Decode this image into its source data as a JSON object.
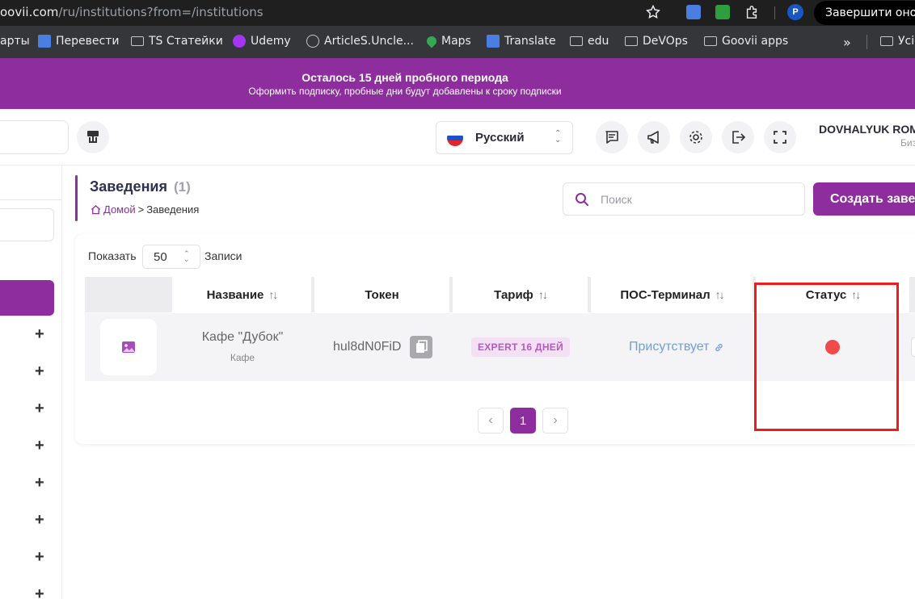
{
  "browser": {
    "url_host": "oovii.com",
    "url_path": "/ru/institutions?from=/institutions",
    "end_session_label": "Завершити оно",
    "profile_initial": "P",
    "bookmarks": [
      {
        "label": "арты",
        "icon": "folder-icon"
      },
      {
        "label": "Перевести",
        "icon": "google-translate-icon"
      },
      {
        "label": "TS Статейки",
        "icon": "folder-icon"
      },
      {
        "label": "Udemy",
        "icon": "udemy-icon"
      },
      {
        "label": "ArticleS.Uncle...",
        "icon": "globe-icon"
      },
      {
        "label": "Maps",
        "icon": "maps-icon"
      },
      {
        "label": "Translate",
        "icon": "google-translate-icon"
      },
      {
        "label": "edu",
        "icon": "folder-icon"
      },
      {
        "label": "DeVOps",
        "icon": "folder-icon"
      },
      {
        "label": "Goovii apps",
        "icon": "folder-icon"
      },
      {
        "label": "»",
        "icon": "overflow-icon"
      },
      {
        "label": "Усі",
        "icon": "folder-icon"
      }
    ]
  },
  "trial": {
    "title": "Осталось 15 дней пробного периода",
    "subtitle": "Оформить подписку, пробные дни будут добавлены к сроку подписки"
  },
  "header": {
    "language": "Русский",
    "user_name": "DOVHALYUK ROM",
    "user_role": "Биз"
  },
  "page": {
    "title": "Заведения",
    "count": "(1)",
    "breadcrumb_home": "Домой",
    "breadcrumb_sep": ">",
    "breadcrumb_current": "Заведения",
    "search_placeholder": "Поиск",
    "create_label": "Создать заве"
  },
  "table": {
    "show_label": "Показать",
    "page_size": "50",
    "records_label": "Записи",
    "columns": [
      {
        "label": "Название",
        "sortable": true
      },
      {
        "label": "Токен",
        "sortable": false
      },
      {
        "label": "Тариф",
        "sortable": true
      },
      {
        "label": "ПОС-Терминал",
        "sortable": true
      },
      {
        "label": "Статус",
        "sortable": true
      }
    ],
    "rows": [
      {
        "name": "Кафе \"Дубок\"",
        "type": "Кафе",
        "token": "hul8dN0FiD",
        "tariff": "EXPERT 16 ДНЕЙ",
        "pos": "Присутствует",
        "status_color": "#f04a4a"
      }
    ]
  },
  "pagination": {
    "prev": "‹",
    "current": "1",
    "next": "›"
  },
  "colors": {
    "brand": "#8d2d9e",
    "status_inactive": "#f04a4a",
    "highlight": "#ee1c1c"
  }
}
